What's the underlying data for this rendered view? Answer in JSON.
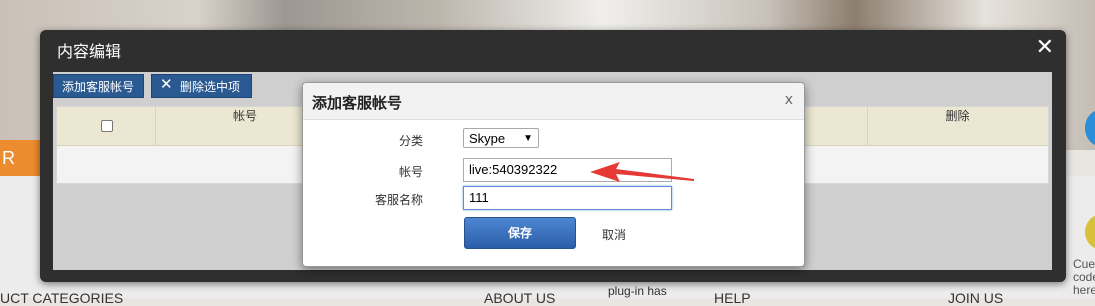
{
  "background": {
    "banner_text": "R CO",
    "footer_items": [
      "UCT CATEGORIES",
      "plug-in has",
      "ABOUT US",
      "HELP",
      "JOIN US"
    ],
    "right_text": "Cue code here"
  },
  "dialog": {
    "title": "内容编辑",
    "close_label": "✕",
    "toolbar": {
      "add_label": "添加客服帐号",
      "delete_label": "删除选中项"
    },
    "grid": {
      "columns": [
        "帐号",
        "删除"
      ]
    }
  },
  "modal": {
    "title": "添加客服帐号",
    "close_label": "x",
    "fields": {
      "category_label": "分类",
      "category_value": "Skype",
      "account_label": "帐号",
      "account_value": "live:540392322",
      "name_label": "客服名称",
      "name_value": "111"
    },
    "save_label": "保存",
    "cancel_label": "取消"
  },
  "colors": {
    "accent": "#2b5a93",
    "arrow": "#e53935"
  }
}
